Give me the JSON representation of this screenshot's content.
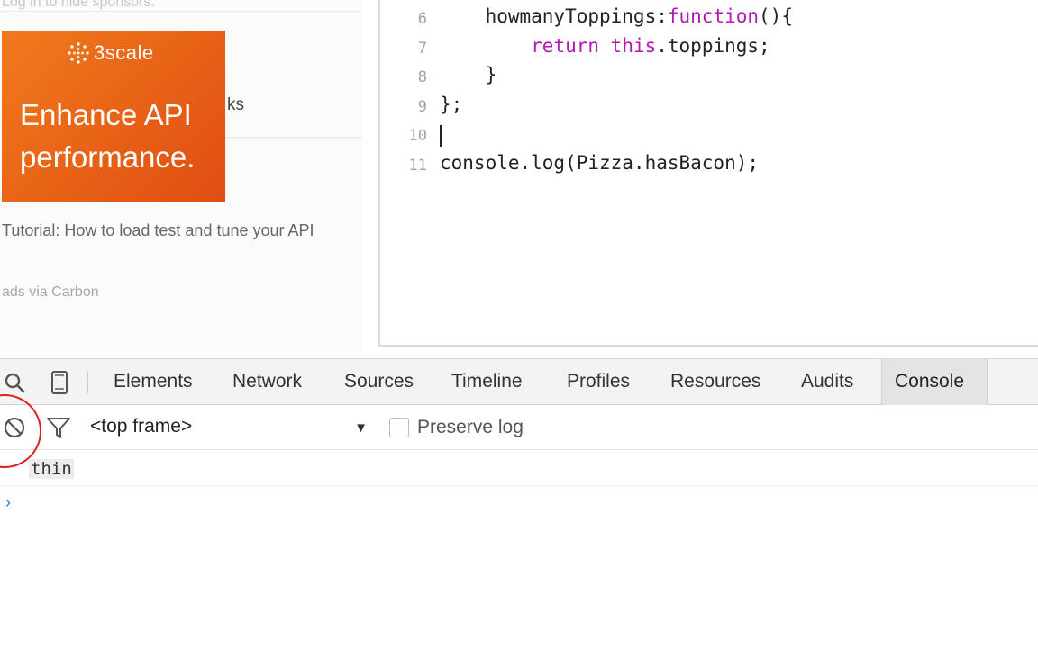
{
  "sidebar": {
    "sponsor_note": "Log in to hide sponsors.",
    "obscured_link_tail": "ks",
    "ad": {
      "logo_text": "3scale",
      "headline": "Enhance API performance.",
      "caption": "Tutorial: How to load test and tune your API",
      "via": "ads via Carbon",
      "colors": {
        "start": "#f07a1c",
        "end": "#e04d12"
      }
    }
  },
  "editor": {
    "lines": [
      {
        "num": "6",
        "parts": [
          {
            "t": "    howmanyToppings:",
            "k": false
          },
          {
            "t": "function",
            "k": true
          },
          {
            "t": "(){",
            "k": false
          }
        ]
      },
      {
        "num": "7",
        "parts": [
          {
            "t": "        ",
            "k": false
          },
          {
            "t": "return",
            "k": true
          },
          {
            "t": " ",
            "k": false
          },
          {
            "t": "this",
            "k": true
          },
          {
            "t": ".toppings;",
            "k": false
          }
        ]
      },
      {
        "num": "8",
        "parts": [
          {
            "t": "    }",
            "k": false
          }
        ]
      },
      {
        "num": "9",
        "parts": [
          {
            "t": "};",
            "k": false
          }
        ]
      },
      {
        "num": "10",
        "parts": [
          {
            "t": "",
            "k": false
          }
        ],
        "caret": true
      },
      {
        "num": "11",
        "parts": [
          {
            "t": "console.log(Pizza.hasBacon);",
            "k": false
          }
        ]
      }
    ],
    "keyword_color": "#b21ab6"
  },
  "devtools": {
    "icons": {
      "search": "search-icon",
      "device": "device-mode-icon",
      "clear": "clear-console-icon",
      "filter": "filter-icon"
    },
    "tabs": [
      "Elements",
      "Network",
      "Sources",
      "Timeline",
      "Profiles",
      "Resources",
      "Audits"
    ],
    "active_tab": "Console",
    "context_select": "<top frame>",
    "preserve_log_label": "Preserve log",
    "preserve_log_checked": false,
    "log_output": "thin",
    "highlight_color": "#e02020"
  }
}
